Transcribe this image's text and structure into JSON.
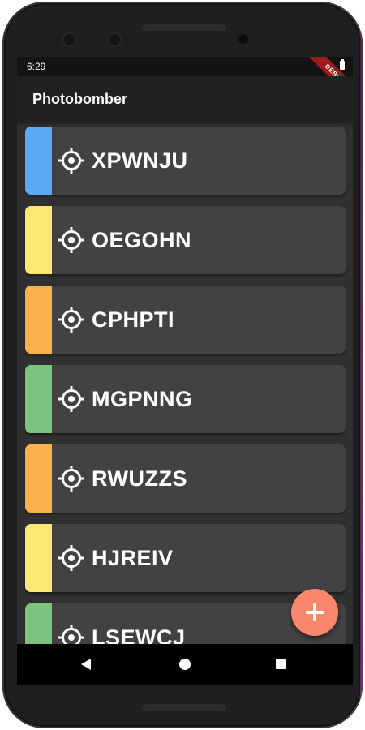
{
  "status_bar": {
    "time": "6:29",
    "debug_label": "DEBUG"
  },
  "app_bar": {
    "title": "Photobomber"
  },
  "items": [
    {
      "label": "XPWNJU",
      "color": "#5aa9f4",
      "icon": "target-icon"
    },
    {
      "label": "OEGOHN",
      "color": "#fde671",
      "icon": "target-icon"
    },
    {
      "label": "CPHPTI",
      "color": "#fdb14c",
      "icon": "target-icon"
    },
    {
      "label": "MGPNNG",
      "color": "#7bc47f",
      "icon": "target-icon"
    },
    {
      "label": "RWUZZS",
      "color": "#fdb14c",
      "icon": "target-icon"
    },
    {
      "label": "HJREIV",
      "color": "#fde671",
      "icon": "target-icon"
    },
    {
      "label": "LSEWCJ",
      "color": "#7bc47f",
      "icon": "target-icon"
    }
  ],
  "fab": {
    "icon": "plus-icon",
    "color": "#f8876b"
  },
  "nav_bar": {
    "icons": [
      "back-icon",
      "home-icon",
      "recents-icon"
    ]
  }
}
